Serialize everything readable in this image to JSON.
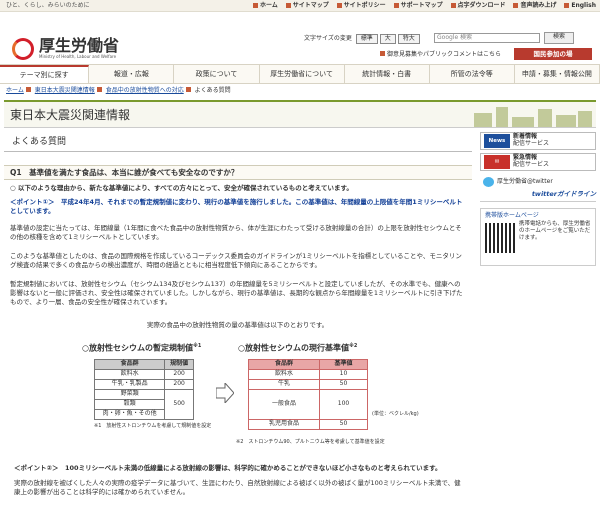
{
  "top": {
    "tagline": "ひと、くらし、みらいのために",
    "links": [
      "ホーム",
      "サイトマップ",
      "サイトポリシー",
      "サポートマップ",
      "点字ダウンロード",
      "音声読み上げ",
      "English"
    ]
  },
  "header": {
    "logo_jp": "厚生労働省",
    "logo_en": "Ministry of Health, Labour and Welfare",
    "fontsize_label": "文字サイズの変更",
    "fontsizes": [
      "標準",
      "大",
      "特大"
    ],
    "search_placeholder": "Google 検索",
    "search_button": "検索",
    "opinion": "御意見募集やパブリックコメントはこちら",
    "nation_btn": "国民参加の場"
  },
  "nav": [
    "テーマ別に探す",
    "報道・広報",
    "政策について",
    "厚生労働省について",
    "統計情報・白書",
    "所管の法令等",
    "申請・募集・情報公開"
  ],
  "breadcrumb": {
    "items": [
      "ホーム",
      "東日本大震災関連情報",
      "食品中の放射性物質への対応"
    ],
    "current": "よくある質問"
  },
  "banner": {
    "title": "東日本大震災関連情報"
  },
  "page": {
    "subtitle": "よくある質問"
  },
  "q1": {
    "label": "Q1",
    "text": "基準値を満たす食品は、本当に誰が食べても安全なのですか？"
  },
  "answer": {
    "lead": "○ 以下のような理由から、新たな基準値により、すべての方々にとって、安全が確保されているものと考えています。",
    "point1": "＜ポイント①＞　平成24年4月、それまでの暫定規制値に変わり、現行の基準値を施行しました。この基準値は、年間線量の上限値を年間1ミリシーベルトとしています。",
    "body": [
      "基準値の設定に当たっては、年間線量（1年間に食べた食品中の放射性物質から、体が生涯にわたって受ける放射線量の合計）の上限を放射性セシウムとその他の核種を含めて1ミリシーベルトとしています。",
      "このような基準値としたのは、食品の国際規格を作成しているコーデックス委員会のガイドラインが1ミリシーベルトを指標としていることや、モニタリング検査の結果で多くの食品からの検出濃度が、時間の経過とともに相当程度低下傾向にあることからです。",
      "暫定規制値においては、放射性セシウム（セシウム134及びセシウム137）の年間線量を5ミリシーベルトと設定していましたが、その水準でも、健康への影響はないと一般に評価され、安全性は確保されていました。しかしながら、現行の基準値は、長期的な観点から年間線量を1ミリシーベルトに引き下げたもので、より一層、食品の安全性が確保されています。"
    ],
    "intro": "実際の食品中の放射性物質の量の基準値は以下のとおりです。"
  },
  "table_old": {
    "caption": "○放射性セシウムの暫定規制値",
    "sup": "※1",
    "headers": [
      "食品群",
      "規制値"
    ],
    "rows": [
      [
        "飲料水",
        "200"
      ],
      [
        "牛乳・乳製品",
        "200"
      ],
      [
        "野菜類",
        "500"
      ],
      [
        "穀類",
        ""
      ],
      [
        "肉・卵・魚・その他",
        ""
      ]
    ],
    "note": "※1　放射性ストロンチウムを考慮して規制値を設定"
  },
  "table_new": {
    "caption": "○放射性セシウムの現行基準値",
    "sup": "※2",
    "headers": [
      "食品群",
      "基準値"
    ],
    "rows": [
      [
        "飲料水",
        "10"
      ],
      [
        "牛乳",
        "50"
      ],
      [
        "一般食品",
        "100"
      ],
      [
        "乳児用食品",
        "50"
      ]
    ],
    "unit": "(単位：ベクレル/kg)",
    "note": "※2　ストロンチウム90、プルトニウム等を考慮して基準値を設定"
  },
  "point2": {
    "heading": "＜ポイント②＞　100ミリシーベルト未満の低線量による放射線の影響は、科学的に確かめることができないほど小さなものと考えられています。",
    "text": "実際の放射線を被ばくした人々の実際の疫学データに基づいて、生涯にわたり、自然放射線による被ばく以外の被ばく量が100ミリシーベルト未満で、健康上の影響が出ることは科学的には確かめられていません。"
  },
  "side": {
    "news": {
      "icon": "News",
      "title": "新着情報",
      "sub": "配信サービス"
    },
    "mail": {
      "icon": "✉",
      "title": "緊急情報",
      "sub": "配信サービス"
    },
    "twitter": "厚生労働省@twitter",
    "twitter_link": "twitterガイドライン",
    "mobile": {
      "title": "携帯版ホームページ",
      "text": "携帯電話からも、厚生労働省のホームページをご覧いただけます。"
    }
  }
}
